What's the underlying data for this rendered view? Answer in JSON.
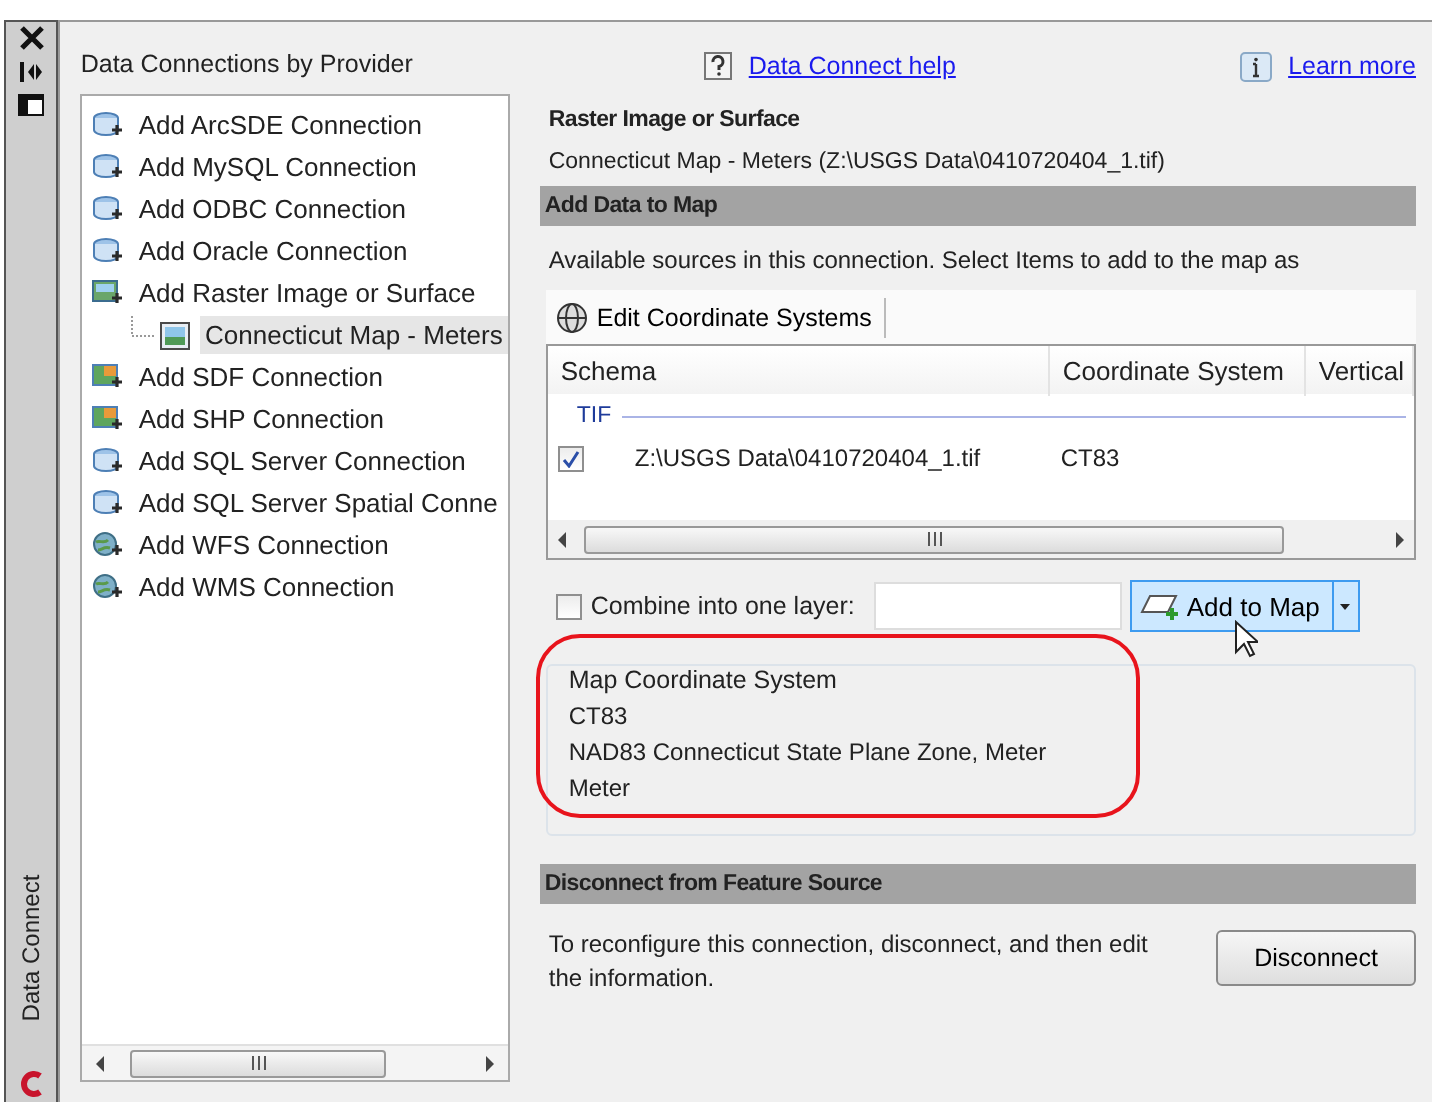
{
  "side_strip": {
    "tab_label": "Data Connect"
  },
  "left_panel": {
    "title": "Data Connections by Provider",
    "tree": [
      {
        "label": "Add ArcSDE Connection",
        "kind": "database",
        "selected": false
      },
      {
        "label": "Add MySQL Connection",
        "kind": "database",
        "selected": false
      },
      {
        "label": "Add ODBC Connection",
        "kind": "database",
        "selected": false
      },
      {
        "label": "Add Oracle Connection",
        "kind": "database",
        "selected": false
      },
      {
        "label": "Add Raster Image or Surface",
        "kind": "raster",
        "selected": false,
        "children": [
          {
            "label": "Connecticut Map - Meters",
            "kind": "image",
            "selected": true
          }
        ]
      },
      {
        "label": "Add SDF Connection",
        "kind": "file",
        "selected": false
      },
      {
        "label": "Add SHP Connection",
        "kind": "file",
        "selected": false
      },
      {
        "label": "Add SQL Server Connection",
        "kind": "database",
        "selected": false
      },
      {
        "label": "Add SQL Server Spatial Conne",
        "kind": "database",
        "selected": false
      },
      {
        "label": "Add WFS Connection",
        "kind": "web",
        "selected": false
      },
      {
        "label": "Add WMS Connection",
        "kind": "web",
        "selected": false
      }
    ]
  },
  "links": [
    {
      "label": "Data Connect help",
      "kind": "help"
    },
    {
      "label": "Learn more",
      "kind": "info"
    }
  ],
  "source": {
    "heading": "Raster Image or Surface",
    "detail": "Connecticut Map - Meters (Z:\\USGS Data\\0410720404_1.tif)"
  },
  "add_data": {
    "header": "Add Data to Map",
    "intro": "Available sources in this connection.  Select Items to add to the map as",
    "toolbar_button": "Edit Coordinate Systems",
    "table": {
      "columns": [
        "Schema",
        "Coordinate System",
        "Vertical"
      ],
      "groups": [
        {
          "label": "TIF",
          "rows": [
            {
              "checked": true,
              "cells": [
                "Z:\\USGS Data\\0410720404_1.tif",
                "CT83"
              ]
            }
          ]
        }
      ]
    },
    "combine": {
      "label": "Combine into one layer:",
      "checked": false
    },
    "add_button": "Add to Map"
  },
  "map_coordinate_system": {
    "title": "Map Coordinate System",
    "highlighted": true,
    "lines": [
      "CT83",
      "NAD83 Connecticut State Plane Zone, Meter",
      "Meter"
    ]
  },
  "disconnect": {
    "header": "Disconnect from Feature Source",
    "text": "To reconfigure this connection, disconnect, and then edit the information.",
    "button": "Disconnect"
  }
}
